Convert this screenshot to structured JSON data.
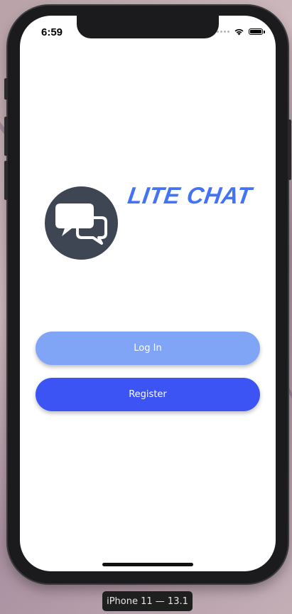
{
  "status_bar": {
    "time": "6:59"
  },
  "app": {
    "title": "LITE CHAT",
    "logo_icon": "chat-bubbles-icon",
    "logo_bg": "#3e4553",
    "title_color": "#4474f4"
  },
  "buttons": {
    "login_label": "Log In",
    "register_label": "Register",
    "login_color": "#80a4f6",
    "register_color": "#3c54f3"
  },
  "simulator": {
    "device_label": "iPhone 11 — 13.1"
  }
}
